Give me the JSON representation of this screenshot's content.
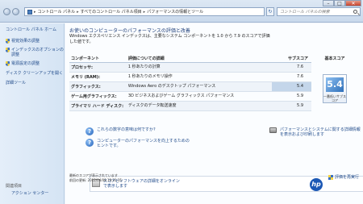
{
  "address": {
    "crumbs": [
      "コントロール パネル",
      "すべてのコントロール パネル項目",
      "パフォーマンスの情報とツール"
    ],
    "search_placeholder": "コントロール パネルの検索"
  },
  "sidebar": {
    "home": "コントロール パネル ホーム",
    "items": [
      {
        "label": "視覚効果の調整"
      },
      {
        "label": "インデックスのオプションの調整"
      },
      {
        "label": "電源設定の調整"
      }
    ],
    "plain_items": [
      {
        "label": "ディスク クリーンアップを開く"
      },
      {
        "label": "詳細ツール"
      }
    ],
    "see_also": "関連項目",
    "action_center": "アクション センター"
  },
  "main": {
    "heading": "お使いのコンピューターのパフォーマンスの評価と改善",
    "description": "Windows エクスペリエンス インデックスは、主要なシステム コンポーネントを 1.0 から 7.9 のスコアで評価した値です。",
    "columns": {
      "component": "コンポーネント",
      "detail": "評価についての詳細",
      "subscore": "サブスコア",
      "base": "基本スコア"
    },
    "rows": [
      {
        "component": "プロセッサ:",
        "detail": "1 秒あたりの計算",
        "score": "7.6"
      },
      {
        "component": "メモリ (RAM):",
        "detail": "1 秒あたりのメモリ操作",
        "score": "7.6"
      },
      {
        "component": "グラフィックス:",
        "detail": "Windows Aero のデスクトップ パフォーマンス",
        "score": "5.4"
      },
      {
        "component": "ゲーム用グラフィックス:",
        "detail": "3D ビジネスおよびゲーム グラフィックス パフォーマンス",
        "score": "5.9"
      },
      {
        "component": "プライマリ ハード ディスク:",
        "detail": "ディスクのデータ転送速度",
        "score": "5.9"
      }
    ],
    "base_score": "5.4",
    "base_caption": "一番低いサブスコア",
    "links": {
      "meaning": "これらの数字の意味は何ですか?",
      "tips": "コンピューターのパフォーマンスを向上するためのヒントです。",
      "software": "スコアとソフトウェアの詳細をオンラインで表示します",
      "print": "パフォーマンスとシステムに関する詳細情報を表示および印刷します"
    },
    "hp_logo": "hp",
    "footer_line1": "最新のスコアが表示されています",
    "footer_line2": "前回の更新: 2012/04/08 19:31:15",
    "rerun": "評価を再実行"
  },
  "window_controls": {
    "minimize": "–",
    "maximize": "□",
    "close": "✕"
  },
  "colors": {
    "accent": "#1f4a8a",
    "badge": "#2e6fb9"
  }
}
